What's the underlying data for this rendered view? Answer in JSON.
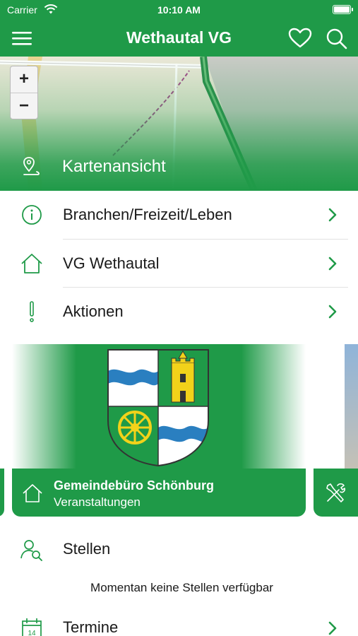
{
  "status_bar": {
    "carrier": "Carrier",
    "time": "10:10 AM"
  },
  "nav": {
    "title": "Wethautal VG",
    "menu_icon": "hamburger-menu-icon",
    "favorite_icon": "heart-icon",
    "search_icon": "search-icon"
  },
  "map": {
    "label": "Kartenansicht",
    "zoom_in": "+",
    "zoom_out": "−",
    "icon": "map-pin-icon"
  },
  "menu_items": [
    {
      "label": "Branchen/Freizeit/Leben",
      "icon": "info-icon"
    },
    {
      "label": "VG Wethautal",
      "icon": "home-icon"
    },
    {
      "label": "Aktionen",
      "icon": "exclamation-icon"
    }
  ],
  "carousel": {
    "main": {
      "title": "Gemeindebüro Schönburg",
      "subtitle": "Veranstaltungen",
      "icon": "home-icon"
    },
    "next": {
      "icon": "tools-icon"
    }
  },
  "stellen": {
    "label": "Stellen",
    "icon": "person-search-icon",
    "empty_text": "Momentan keine Stellen verfügbar"
  },
  "termine": {
    "label": "Termine",
    "icon": "calendar-icon"
  },
  "colors": {
    "brand_green": "#1f9a48",
    "text": "#1a1a1a",
    "divider": "#e2e2e2"
  }
}
